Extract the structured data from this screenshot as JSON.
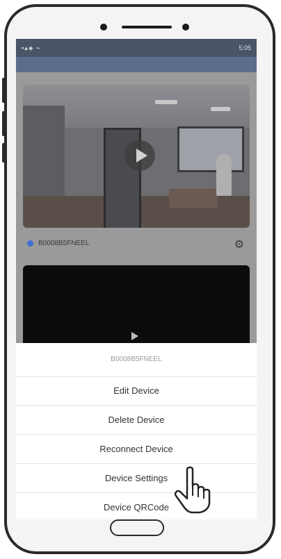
{
  "status_bar": {
    "left_icons": "▪▴◈ ⌁",
    "right_text": "5:05"
  },
  "header": {
    "title": ""
  },
  "device": {
    "name": "B0008B5FNEEL"
  },
  "sheet": {
    "title": "B0008B5FNEEL",
    "actions": [
      "Edit Device",
      "Delete Device",
      "Reconnect Device",
      "Device Settings",
      "Device QRCode"
    ]
  },
  "colors": {
    "online_dot": "#3f6fd1",
    "status_bar": "#4a5567",
    "sheet_bg": "#ffffff"
  },
  "icons": {
    "online": "dot-icon",
    "settings": "gear-icon",
    "play": "play-icon",
    "tap": "hand-pointer-icon"
  }
}
